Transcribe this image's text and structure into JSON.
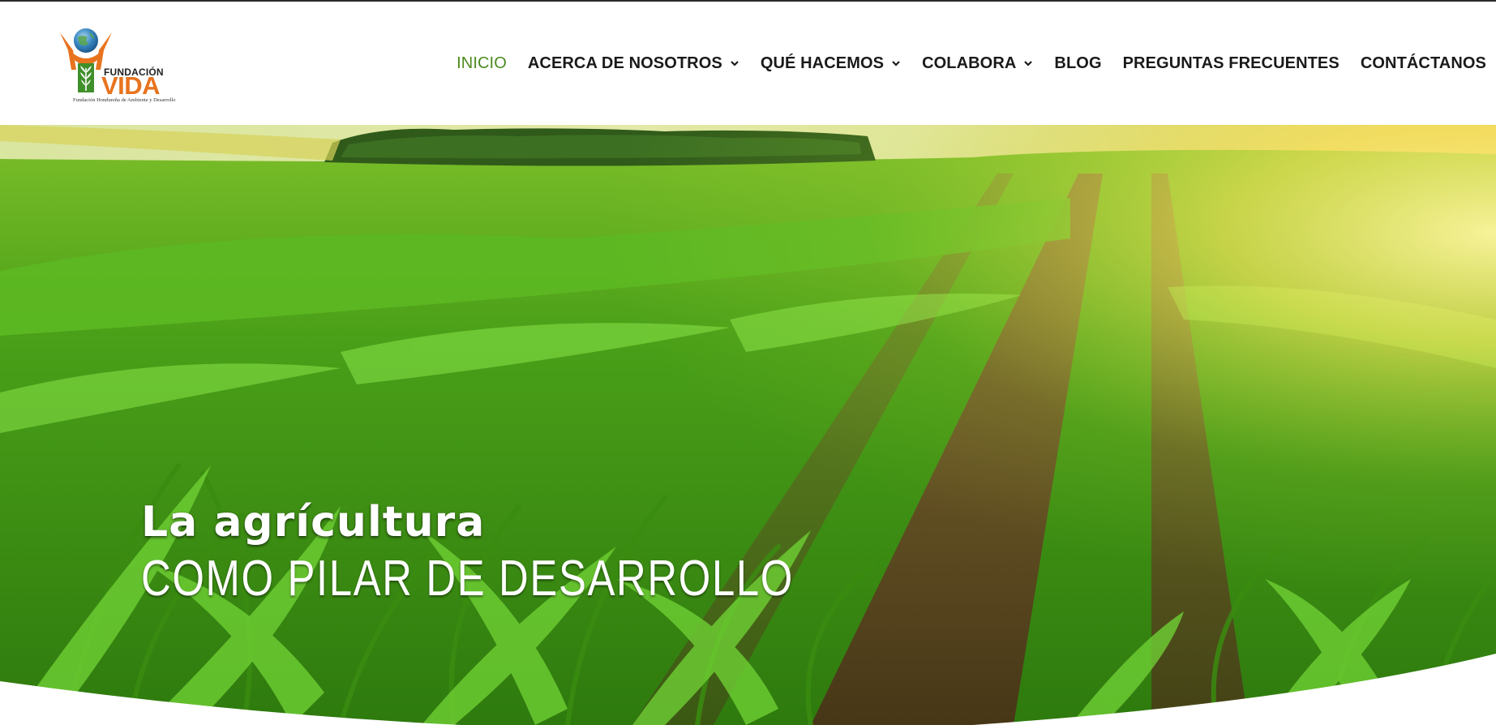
{
  "brand": {
    "name_top": "FUNDACIÓN",
    "name_main": "VIDA",
    "subtitle": "Fundación Hondureña de Ambiente y Desarrollo",
    "colors": {
      "orange": "#e8731f",
      "green": "#3f8f2a",
      "globe": "#2f7fb8"
    }
  },
  "nav": {
    "items": [
      {
        "label": "INICIO",
        "active": true,
        "dropdown": false
      },
      {
        "label": "ACERCA DE NOSOTROS",
        "active": false,
        "dropdown": true
      },
      {
        "label": "QUÉ HACEMOS",
        "active": false,
        "dropdown": true
      },
      {
        "label": "COLABORA",
        "active": false,
        "dropdown": true
      },
      {
        "label": "BLOG",
        "active": false,
        "dropdown": false
      },
      {
        "label": "PREGUNTAS FRECUENTES",
        "active": false,
        "dropdown": false
      },
      {
        "label": "CONTÁCTANOS",
        "active": false,
        "dropdown": false
      }
    ],
    "active_color": "#4c8a1e",
    "dropdown_icon": "chevron-down-icon"
  },
  "hero": {
    "line1": "La agrícultura",
    "line2": "COMO PILAR DE DESARROLLO",
    "image": "cornfield-rows-sunlight"
  }
}
